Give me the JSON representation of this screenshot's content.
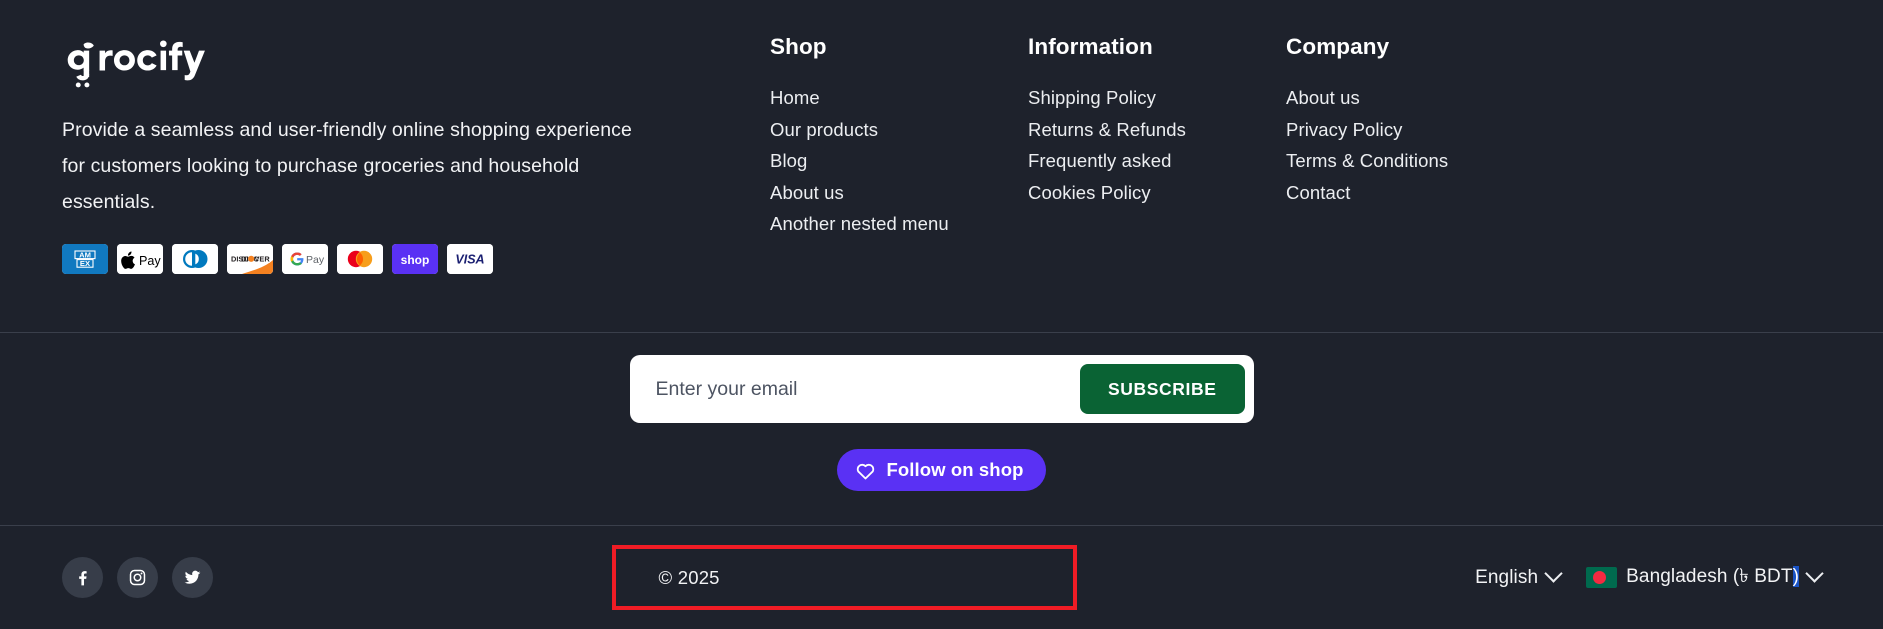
{
  "brand": {
    "logo_text": "grocify",
    "logo_icon": "grocify-cart-leaf-logo",
    "tagline": "Provide a seamless and user-friendly online shopping experience for customers looking to purchase groceries and household essentials."
  },
  "payment_methods": [
    {
      "name": "american-express",
      "label": "AMEX"
    },
    {
      "name": "apple-pay",
      "label": "Apple Pay"
    },
    {
      "name": "diners-club",
      "label": "Diners Club"
    },
    {
      "name": "discover",
      "label": "DISCOVER"
    },
    {
      "name": "google-pay",
      "label": "G Pay"
    },
    {
      "name": "mastercard",
      "label": "Mastercard"
    },
    {
      "name": "shop-pay",
      "label": "shop"
    },
    {
      "name": "visa",
      "label": "VISA"
    }
  ],
  "nav_columns": [
    {
      "title": "Shop",
      "links": [
        "Home",
        "Our products",
        "Blog",
        "About us",
        "Another nested menu"
      ]
    },
    {
      "title": "Information",
      "links": [
        "Shipping Policy",
        "Returns & Refunds",
        "Frequently asked",
        "Cookies Policy"
      ]
    },
    {
      "title": "Company",
      "links": [
        "About us",
        "Privacy Policy",
        "Terms & Conditions",
        "Contact"
      ]
    }
  ],
  "newsletter": {
    "placeholder": "Enter your email",
    "value": "",
    "subscribe_label": "SUBSCRIBE",
    "button_color": "#0a6334"
  },
  "follow_shop": {
    "label": "Follow on shop",
    "icon": "heart-icon",
    "color": "#5a31f4"
  },
  "socials": [
    {
      "name": "facebook",
      "icon": "facebook-icon"
    },
    {
      "name": "instagram",
      "icon": "instagram-icon"
    },
    {
      "name": "twitter",
      "icon": "twitter-icon"
    }
  ],
  "bottom": {
    "copyright": "© 2025",
    "highlight_color": "#f01c25",
    "language": "English",
    "country_currency_prefix": "Bangladesh (৳ BDT",
    "country_currency_selected": ")",
    "country_flag": "bangladesh-flag",
    "selection_color": "#1a53c4"
  },
  "theme": {
    "background": "#1e222c",
    "divider": "#3a3f4b",
    "text": "#f2f3f5",
    "social_bg": "#373d49"
  }
}
